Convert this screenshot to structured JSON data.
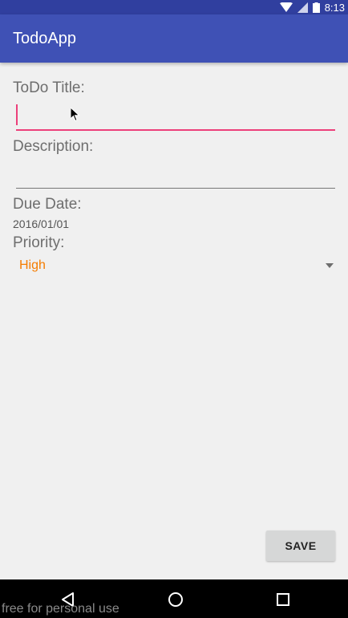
{
  "status_bar": {
    "time": "8:13",
    "icons": [
      "wifi-icon",
      "signal-icon",
      "battery-icon"
    ]
  },
  "app_bar": {
    "title": "TodoApp"
  },
  "form": {
    "title_label": "ToDo Title:",
    "title_value": "",
    "description_label": "Description:",
    "description_value": "",
    "due_date_label": "Due Date:",
    "due_date_value": "2016/01/01",
    "priority_label": "Priority:",
    "priority_value": "High"
  },
  "actions": {
    "save_label": "SAVE"
  },
  "nav_bar": {
    "icons": [
      "back-icon",
      "home-icon",
      "recents-icon"
    ]
  },
  "watermark": "free for personal use",
  "colors": {
    "primary": "#3f51b5",
    "primary_dark": "#303f9f",
    "accent": "#ec407a",
    "priority_text": "#f57c00"
  }
}
